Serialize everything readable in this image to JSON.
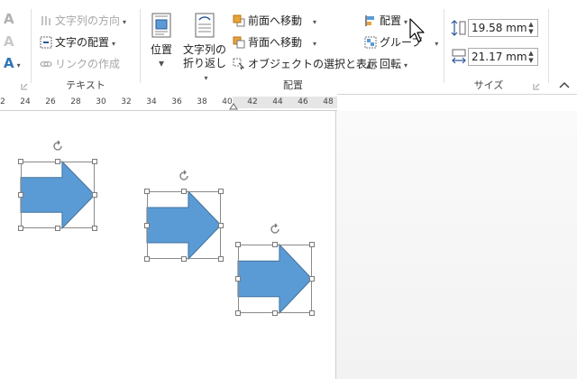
{
  "ribbon": {
    "text_group": {
      "label": "テキスト",
      "text_direction": "文字列の方向",
      "align_text": "文字の配置",
      "create_link": "リンクの作成"
    },
    "arrange_group": {
      "label": "配置",
      "position": "位置",
      "wrap_text_line1": "文字列の",
      "wrap_text_line2": "折り返し",
      "bring_forward": "前面へ移動",
      "send_backward": "背面へ移動",
      "selection_pane": "オブジェクトの選択と表示",
      "align": "配置",
      "group": "グループ",
      "rotate": "回転"
    },
    "size_group": {
      "label": "サイズ",
      "height_value": "19.58 mm",
      "width_value": "21.17 mm"
    }
  },
  "ruler": {
    "ticks": [
      "2",
      "24",
      "26",
      "28",
      "30",
      "32",
      "34",
      "36",
      "38",
      "40",
      "42",
      "44",
      "46",
      "48"
    ]
  },
  "colors": {
    "arrow_fill": "#5b9bd5",
    "arrow_stroke": "#41719c",
    "accent": "#2b579a"
  }
}
